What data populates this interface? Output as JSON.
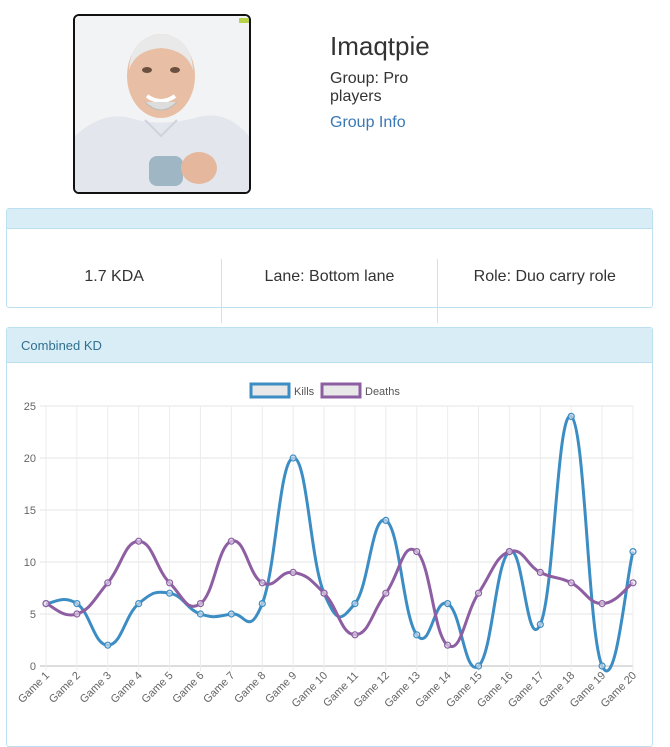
{
  "profile": {
    "name": "Imaqtpie",
    "group": "Group: Pro players",
    "group_link": "Group Info"
  },
  "stats": {
    "kda": "1.7 KDA",
    "lane": "Lane: Bottom lane",
    "role": "Role: Duo carry role"
  },
  "panel": {
    "title": "Combined KD"
  },
  "colors": {
    "kills": "#3c8dc4",
    "deaths": "#8e5ea2",
    "panel_header": "#d9edf7",
    "link": "#3a78b5"
  },
  "chart_data": {
    "type": "line",
    "title": "",
    "categories": [
      "Game 1",
      "Game 2",
      "Game 3",
      "Game 4",
      "Game 5",
      "Game 6",
      "Game 7",
      "Game 8",
      "Game 9",
      "Game 10",
      "Game 11",
      "Game 12",
      "Game 13",
      "Game 14",
      "Game 15",
      "Game 16",
      "Game 17",
      "Game 18",
      "Game 19",
      "Game 20"
    ],
    "series": [
      {
        "name": "Kills",
        "color": "#3c8dc4",
        "values": [
          6,
          6,
          2,
          6,
          7,
          5,
          5,
          6,
          20,
          7,
          6,
          14,
          3,
          6,
          0,
          11,
          4,
          24,
          0,
          11
        ]
      },
      {
        "name": "Deaths",
        "color": "#8e5ea2",
        "values": [
          6,
          5,
          8,
          12,
          8,
          6,
          12,
          8,
          9,
          7,
          3,
          7,
          11,
          2,
          7,
          11,
          9,
          8,
          6,
          8
        ]
      }
    ],
    "ylim": [
      0,
      25
    ],
    "yticks": [
      0,
      5,
      10,
      15,
      20,
      25
    ],
    "grid": true,
    "legend": "top"
  }
}
